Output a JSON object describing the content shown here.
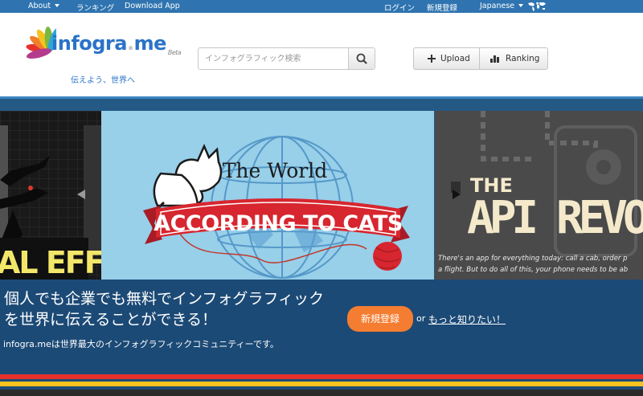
{
  "topnav": {
    "about": "About",
    "ranking": "ランキング",
    "download_app": "Download App",
    "login": "ログイン",
    "signup": "新規登録",
    "language": "Japanese"
  },
  "header": {
    "logo_main": "infogra",
    "logo_dot": ".",
    "logo_me": "me",
    "logo_beta": "Beta",
    "tagline": "伝えよう、世界へ",
    "search_placeholder": "インフォグラフィック検索",
    "upload_label": "Upload",
    "ranking_label": "Ranking"
  },
  "carousel": {
    "left_text": "AL EFFECTS",
    "center_line1": "The World",
    "center_line2": "ACCORDING TO CATS",
    "right_line1": "THE",
    "right_line2": "API REVOLU",
    "right_caption1": "There's an app for everything today: call a cab, order p",
    "right_caption2": "a flight. But to do all of this, your phone needs to be ab"
  },
  "hero": {
    "title_line1": "個人でも企業でも無料でインフォグラフィック",
    "title_line2": "を世界に伝えることができる！",
    "subtitle": "infogra.meは世界最大のインフォグラフィックコミュニティーです。",
    "cta_label": "新規登録",
    "or_text": "or",
    "more_link": "もっと知りたい！"
  },
  "colors": {
    "nav_blue": "#2f74b0",
    "brand_blue": "#2a73c7",
    "hero_navy": "#1c4a76",
    "cta_orange": "#f47d31",
    "ribbon_red": "#d7262f"
  },
  "icons": [
    "caret-down-icon",
    "world-map-icon",
    "search-icon",
    "plus-icon",
    "ranking-bars-icon",
    "prev-arrow-icon",
    "next-arrow-icon"
  ]
}
